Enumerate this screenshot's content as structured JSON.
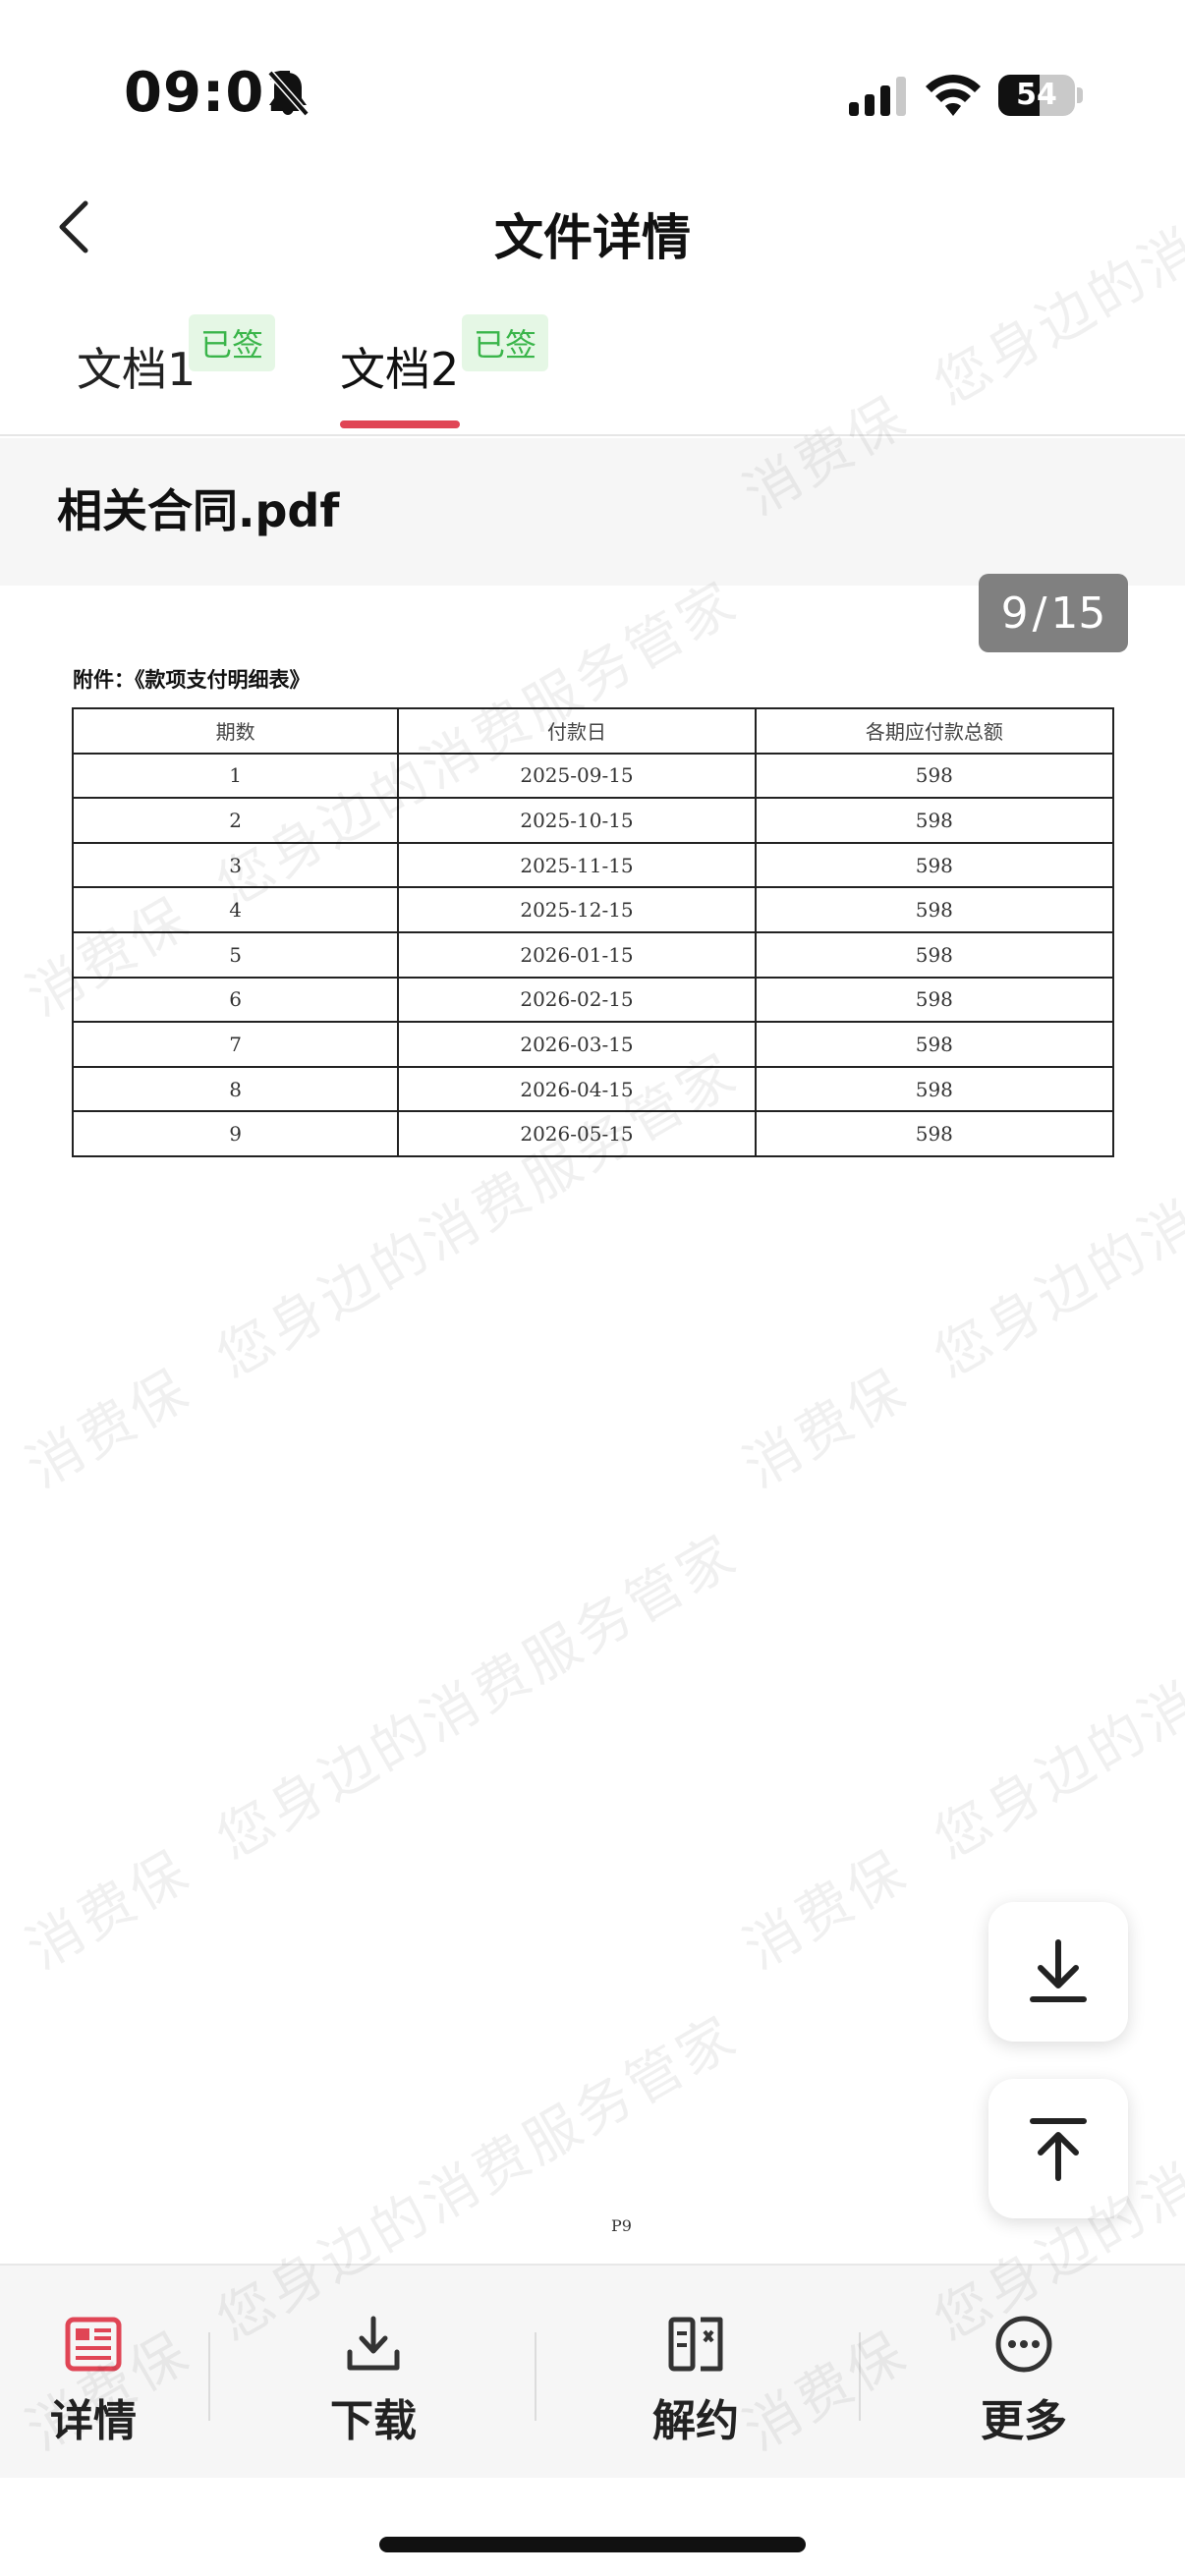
{
  "status_bar": {
    "time": "09:01",
    "battery": "54",
    "battery_level": 0.54,
    "icons": [
      "bell-off-icon",
      "signal-icon",
      "wifi-icon",
      "battery-icon"
    ]
  },
  "nav": {
    "title": "文件详情",
    "back_icon": "chevron-left-icon"
  },
  "tabs": [
    {
      "label": "文档1",
      "badge": "已签",
      "active": false
    },
    {
      "label": "文档2",
      "badge": "已签",
      "active": true
    }
  ],
  "file": {
    "name": "相关合同.pdf"
  },
  "pager": {
    "current": "9",
    "separator": "/",
    "total": "15"
  },
  "document": {
    "heading": "附件：《款项支付明细表》",
    "table": {
      "headers": [
        "期数",
        "付款日",
        "各期应付款总额"
      ],
      "rows": [
        [
          "1",
          "2025-09-15",
          "598"
        ],
        [
          "2",
          "2025-10-15",
          "598"
        ],
        [
          "3",
          "2025-11-15",
          "598"
        ],
        [
          "4",
          "2025-12-15",
          "598"
        ],
        [
          "5",
          "2026-01-15",
          "598"
        ],
        [
          "6",
          "2026-02-15",
          "598"
        ],
        [
          "7",
          "2026-03-15",
          "598"
        ],
        [
          "8",
          "2026-04-15",
          "598"
        ],
        [
          "9",
          "2026-05-15",
          "598"
        ]
      ]
    },
    "page_number": "P9"
  },
  "floating_buttons": [
    {
      "icon": "download-icon"
    },
    {
      "icon": "arrow-up-to-top-icon"
    }
  ],
  "toolbar": {
    "items": [
      {
        "label": "详情",
        "icon": "document-details-icon",
        "color": "#e04555"
      },
      {
        "label": "下载",
        "icon": "download-tray-icon",
        "color": "#333333"
      },
      {
        "label": "解约",
        "icon": "terminate-contract-icon",
        "color": "#333333"
      },
      {
        "label": "更多",
        "icon": "more-dots-icon",
        "color": "#333333"
      }
    ]
  },
  "watermark": {
    "lines": [
      "您身边的消费服务管家",
      "消费保"
    ]
  },
  "colors": {
    "accent_red": "#e04555",
    "signed_green": "#3ab54a",
    "signed_bg": "#e5f7e5",
    "pager_bg": "#808080"
  }
}
